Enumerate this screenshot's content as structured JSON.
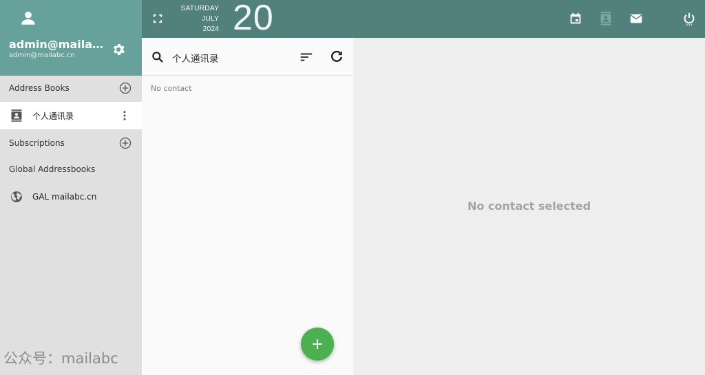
{
  "user": {
    "display_name": "admin@mailabc.cn",
    "email": "admin@mailabc.cn",
    "icons": {
      "avatar": "person-icon",
      "settings": "gear-icon"
    }
  },
  "sidebar": {
    "address_books_label": "Address Books",
    "address_books": [
      {
        "label": "个人通讯录",
        "icon": "contact-book-icon",
        "active": true
      }
    ],
    "subscriptions_label": "Subscriptions",
    "global_label": "Global Addressbooks",
    "global_items": [
      {
        "label": "GAL mailabc.cn",
        "icon": "globe-icon"
      }
    ]
  },
  "topbar": {
    "weekday": "SATURDAY",
    "month": "JULY",
    "year": "2024",
    "day": "20",
    "apps": [
      {
        "name": "calendar",
        "icon": "calendar-icon",
        "active": false
      },
      {
        "name": "contacts",
        "icon": "contacts-icon",
        "active": true
      },
      {
        "name": "mail",
        "icon": "mail-icon",
        "active": false
      }
    ],
    "logout_icon": "power-icon"
  },
  "list": {
    "title": "个人通讯录",
    "empty_text": "No contact",
    "fab_label": "+"
  },
  "detail": {
    "empty_text": "No contact selected"
  },
  "watermark": "公众号：mailabc",
  "colors": {
    "sidebar_header": "#67a19b",
    "topbar": "#52817d",
    "fab": "#4caf50"
  }
}
